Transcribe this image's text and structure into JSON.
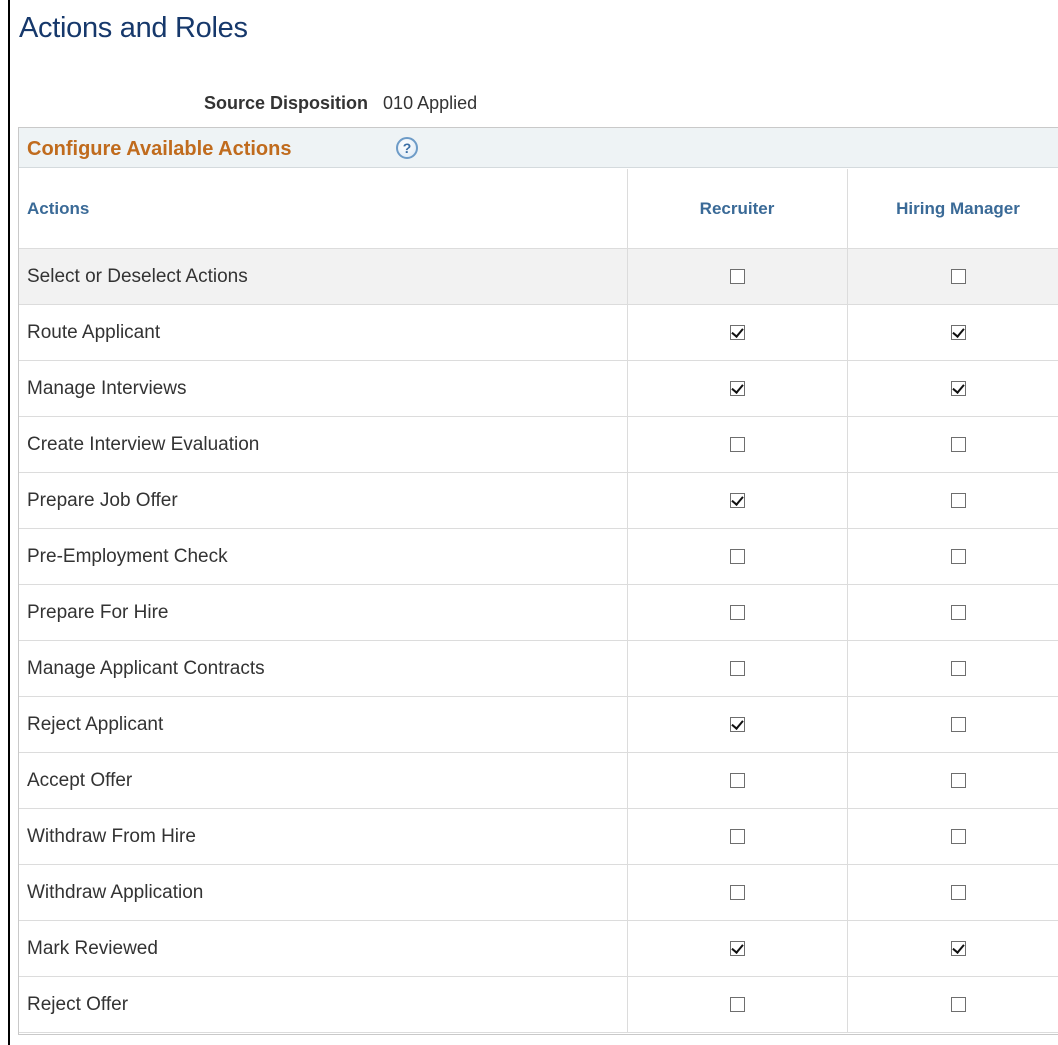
{
  "page_title": "Actions and Roles",
  "source": {
    "label": "Source Disposition",
    "value": "010 Applied"
  },
  "grid": {
    "title": "Configure Available Actions",
    "help_glyph": "?",
    "columns": [
      "Actions",
      "Recruiter",
      "Hiring Manager"
    ],
    "rows": [
      {
        "label": "Select or Deselect Actions",
        "recruiter": false,
        "hiring_manager": false
      },
      {
        "label": "Route Applicant",
        "recruiter": true,
        "hiring_manager": true
      },
      {
        "label": "Manage Interviews",
        "recruiter": true,
        "hiring_manager": true
      },
      {
        "label": "Create Interview Evaluation",
        "recruiter": false,
        "hiring_manager": false
      },
      {
        "label": "Prepare Job Offer",
        "recruiter": true,
        "hiring_manager": false
      },
      {
        "label": "Pre-Employment Check",
        "recruiter": false,
        "hiring_manager": false
      },
      {
        "label": "Prepare For Hire",
        "recruiter": false,
        "hiring_manager": false
      },
      {
        "label": "Manage Applicant Contracts",
        "recruiter": false,
        "hiring_manager": false
      },
      {
        "label": "Reject Applicant",
        "recruiter": true,
        "hiring_manager": false
      },
      {
        "label": "Accept Offer",
        "recruiter": false,
        "hiring_manager": false
      },
      {
        "label": "Withdraw From Hire",
        "recruiter": false,
        "hiring_manager": false
      },
      {
        "label": "Withdraw Application",
        "recruiter": false,
        "hiring_manager": false
      },
      {
        "label": "Mark Reviewed",
        "recruiter": true,
        "hiring_manager": true
      },
      {
        "label": "Reject Offer",
        "recruiter": false,
        "hiring_manager": false
      }
    ]
  },
  "colors": {
    "title": "#16386b",
    "grid_title": "#c06b1d",
    "column_header": "#3a6a97"
  }
}
